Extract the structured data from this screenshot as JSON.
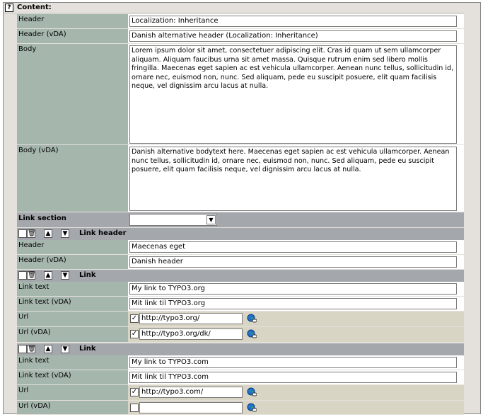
{
  "section_title": "Content:",
  "help_icon": "?",
  "fields": {
    "header": {
      "label": "Header",
      "value": "Localization: Inheritance"
    },
    "header_vda": {
      "label": "Header (vDA)",
      "value": "Danish alternative header (Localization: Inheritance)"
    },
    "body": {
      "label": "Body",
      "value": "Lorem ipsum dolor sit amet, consectetuer adipiscing elit. Cras id quam ut sem ullamcorper aliquam. Aliquam faucibus urna sit amet massa. Quisque rutrum enim sed libero mollis fringilla. Maecenas eget sapien ac est vehicula ullamcorper. Aenean nunc tellus, sollicitudin id, ornare nec, euismod non, nunc. Sed aliquam, pede eu suscipit posuere, elit quam facilisis neque, vel dignissim arcu lacus at nulla."
    },
    "body_vda": {
      "label": "Body (vDA)",
      "value": "Danish alternative bodytext here. Maecenas eget sapien ac est vehicula ullamcorper. Aenean nunc tellus, sollicitudin id, ornare nec, euismod non, nunc. Sed aliquam, pede eu suscipit posuere, elit quam facilisis neque, vel dignissim arcu lacus at nulla."
    }
  },
  "link_section": {
    "label": "Link section",
    "selected": ""
  },
  "link_header_block": {
    "title": "Link header",
    "header": {
      "label": "Header",
      "value": "Maecenas eget"
    },
    "header_vda": {
      "label": "Header (vDA)",
      "value": "Danish header"
    }
  },
  "links": [
    {
      "title": "Link",
      "link_text": {
        "label": "Link text",
        "value": "My link to TYPO3.org"
      },
      "link_text_vda": {
        "label": "Link text (vDA)",
        "value": "Mit link til TYPO3.org"
      },
      "url": {
        "label": "Url",
        "checked": true,
        "value": "http://typo3.org/"
      },
      "url_vda": {
        "label": "Url (vDA)",
        "checked": true,
        "value": "http://typo3.org/dk/"
      }
    },
    {
      "title": "Link",
      "link_text": {
        "label": "Link text",
        "value": "My link to TYPO3.com"
      },
      "link_text_vda": {
        "label": "Link text (vDA)",
        "value": "Mit link til TYPO3.com"
      },
      "url": {
        "label": "Url",
        "checked": true,
        "value": "http://typo3.com/"
      },
      "url_vda": {
        "label": "Url (vDA)",
        "checked": false,
        "value": ""
      }
    }
  ],
  "icons": {
    "help": "help-icon",
    "trash": "trash-icon",
    "move_up": "move-up-icon",
    "move_down": "move-down-icon",
    "globe": "link-browser-icon",
    "checkmark": "✓",
    "dropdown": "▼",
    "up_arrow": "▲",
    "down_arrow": "▼",
    "trash_glyph": "🗑"
  }
}
